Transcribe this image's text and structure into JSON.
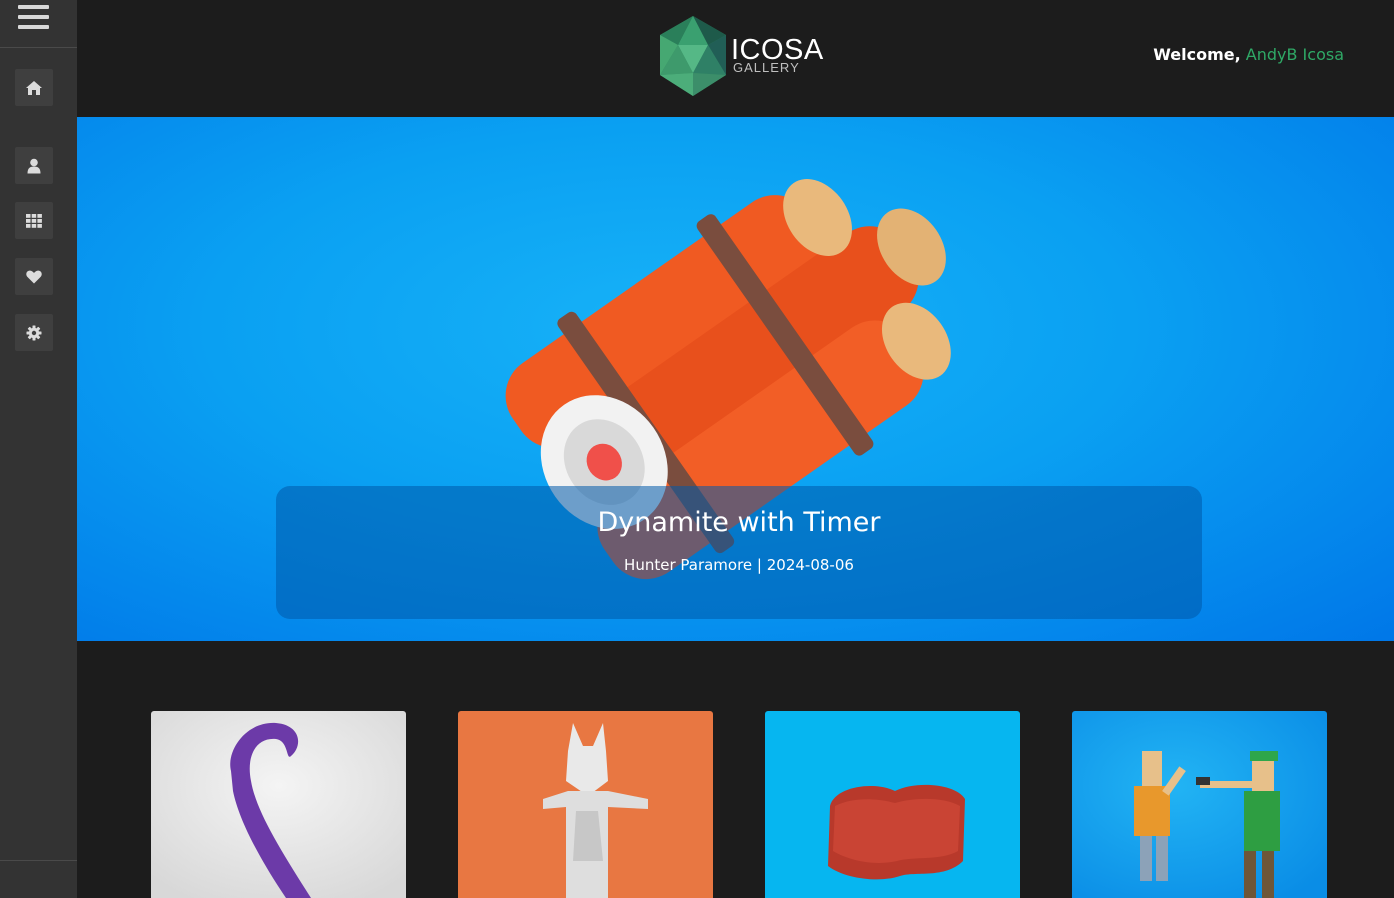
{
  "sidebar": {
    "menu_icon": "hamburger-menu-icon",
    "items": [
      {
        "name": "home",
        "icon": "home-icon"
      },
      {
        "name": "profile",
        "icon": "user-icon"
      },
      {
        "name": "gallery",
        "icon": "grid-icon"
      },
      {
        "name": "likes",
        "icon": "heart-icon"
      },
      {
        "name": "settings",
        "icon": "gear-icon"
      }
    ]
  },
  "header": {
    "logo_title": "ICOSA",
    "logo_subtitle": "GALLERY",
    "welcome_prefix": "Welcome,",
    "username": "AndyB Icosa"
  },
  "hero": {
    "title": "Dynamite with Timer",
    "meta": "Hunter Paramore | 2024-08-06"
  },
  "colors": {
    "background": "#1c1c1c",
    "sidebar": "#333333",
    "accent_green": "#2fa866",
    "hero_blue": "#0aa0f2"
  }
}
